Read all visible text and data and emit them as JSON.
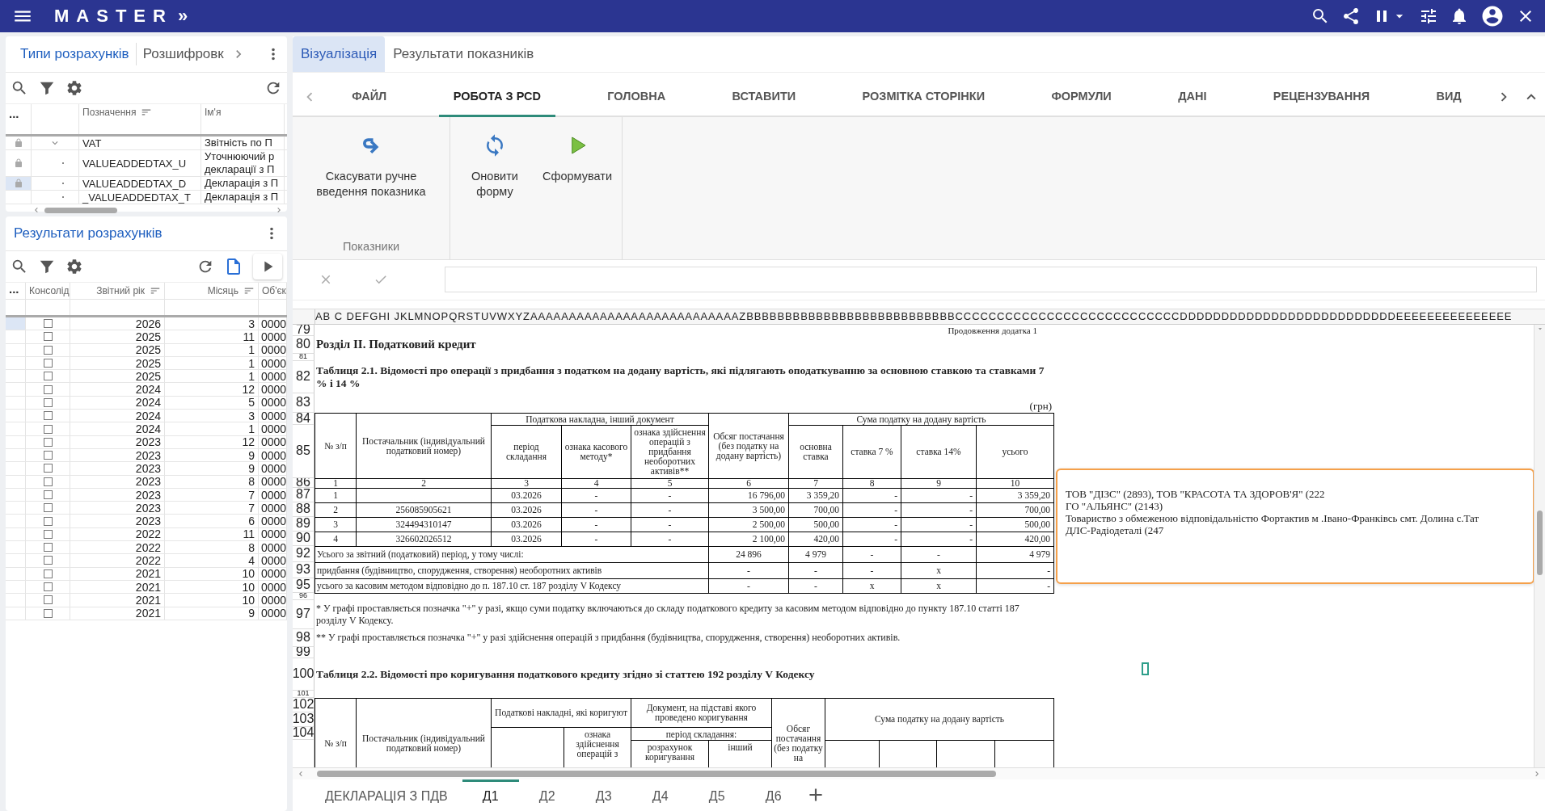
{
  "app_bar": {
    "title": "MASTER",
    "expand": "»"
  },
  "calc_types": {
    "tabs": [
      {
        "label": "Типи розрахунків",
        "selected": true
      },
      {
        "label": "Розшифровк",
        "selected": false
      }
    ],
    "more_label": "...",
    "columns": [
      {
        "label": "Позначення",
        "sorted": true
      },
      {
        "label": "Ім'я",
        "sorted": false
      }
    ],
    "rows": [
      {
        "code": "VAT",
        "name": "Звітність по П",
        "locked": true,
        "selected": false,
        "expanded": true,
        "children": [
          {
            "code": "VALUEADDEDTAX_U",
            "name": "Уточнюючий р декларації з П",
            "locked": true,
            "selected": false
          },
          {
            "code": "VALUEADDEDTAX_D",
            "name": "Декларація з П",
            "locked": true,
            "selected": true
          },
          {
            "code": "_VALUEADDEDTAX_T",
            "name": "Декларація з П",
            "locked": false,
            "selected": false
          }
        ]
      }
    ]
  },
  "calc_results": {
    "title": "Результати розрахунків",
    "more_label": "...",
    "columns": [
      {
        "label": "Консолід",
        "sorted": false
      },
      {
        "label": "Звітний рік",
        "sorted": true
      },
      {
        "label": "Місяць",
        "sorted": true
      },
      {
        "label": "Об'єк",
        "sorted": false
      }
    ],
    "rows": [
      {
        "consolidated": false,
        "year": "2026",
        "month": "3",
        "object": "0000",
        "selected": true
      },
      {
        "consolidated": false,
        "year": "2025",
        "month": "11",
        "object": "0000",
        "selected": false
      },
      {
        "consolidated": false,
        "year": "2025",
        "month": "1",
        "object": "0000",
        "selected": false
      },
      {
        "consolidated": false,
        "year": "2025",
        "month": "1",
        "object": "0000",
        "selected": false
      },
      {
        "consolidated": false,
        "year": "2025",
        "month": "1",
        "object": "0000",
        "selected": false
      },
      {
        "consolidated": false,
        "year": "2024",
        "month": "12",
        "object": "0000",
        "selected": false
      },
      {
        "consolidated": false,
        "year": "2024",
        "month": "5",
        "object": "0000",
        "selected": false
      },
      {
        "consolidated": false,
        "year": "2024",
        "month": "3",
        "object": "0000",
        "selected": false
      },
      {
        "consolidated": false,
        "year": "2024",
        "month": "1",
        "object": "0000",
        "selected": false
      },
      {
        "consolidated": false,
        "year": "2023",
        "month": "12",
        "object": "0000",
        "selected": false
      },
      {
        "consolidated": false,
        "year": "2023",
        "month": "9",
        "object": "0000",
        "selected": false
      },
      {
        "consolidated": false,
        "year": "2023",
        "month": "9",
        "object": "0000",
        "selected": false
      },
      {
        "consolidated": false,
        "year": "2023",
        "month": "8",
        "object": "0000",
        "selected": false
      },
      {
        "consolidated": false,
        "year": "2023",
        "month": "7",
        "object": "0000",
        "selected": false
      },
      {
        "consolidated": false,
        "year": "2023",
        "month": "7",
        "object": "0000",
        "selected": false
      },
      {
        "consolidated": false,
        "year": "2023",
        "month": "6",
        "object": "0000",
        "selected": false
      },
      {
        "consolidated": false,
        "year": "2022",
        "month": "11",
        "object": "0000",
        "selected": false
      },
      {
        "consolidated": false,
        "year": "2022",
        "month": "8",
        "object": "0000",
        "selected": false
      },
      {
        "consolidated": false,
        "year": "2022",
        "month": "4",
        "object": "0000",
        "selected": false
      },
      {
        "consolidated": false,
        "year": "2021",
        "month": "10",
        "object": "0000",
        "selected": false
      },
      {
        "consolidated": false,
        "year": "2021",
        "month": "10",
        "object": "0000",
        "selected": false
      },
      {
        "consolidated": false,
        "year": "2021",
        "month": "10",
        "object": "0000",
        "selected": false
      },
      {
        "consolidated": false,
        "year": "2021",
        "month": "9",
        "object": "0000",
        "selected": false
      }
    ]
  },
  "view_tabs": [
    {
      "label": "Візуалізація",
      "selected": true
    },
    {
      "label": "Результати показників",
      "selected": false
    }
  ],
  "ribbon_tabs": [
    {
      "label": "ФАЙЛ",
      "selected": false
    },
    {
      "label": "РОБОТА З РСD",
      "selected": true
    },
    {
      "label": "ГОЛОВНА",
      "selected": false
    },
    {
      "label": "ВСТАВИТИ",
      "selected": false
    },
    {
      "label": "РОЗМІТКА СТОРІНКИ",
      "selected": false
    },
    {
      "label": "ФОРМУЛИ",
      "selected": false
    },
    {
      "label": "ДАНІ",
      "selected": false
    },
    {
      "label": "РЕЦЕНЗУВАННЯ",
      "selected": false
    },
    {
      "label": "ВИД",
      "selected": false
    }
  ],
  "ribbon_groups": [
    {
      "label": "Показники",
      "buttons": [
        {
          "label": "Скасувати ручне введення показника",
          "kind": "undo"
        }
      ]
    },
    {
      "buttons": [
        {
          "label": "Оновити форму",
          "kind": "refresh"
        },
        {
          "label": "Сформувати",
          "kind": "run"
        }
      ]
    }
  ],
  "sheet": {
    "column_letters": "AB C DEFGHI JKLMNOPQRSTUVWXYZAAAAAAAAAAAAAAAAAAAAAAAAAAAZBBBBBBBBBBBBBBBBBBBBBBBBBBBCCCCCCCCCCCCCCCCCCCCCCCCCCCDDDDDDDDDDDDDDDDDDDDDDDDDDEEEEEEEEEEEEEEE",
    "blocks": [
      {
        "kind": "note",
        "row": "79",
        "text": "Продовження додатка 1"
      },
      {
        "kind": "heading",
        "row": "80",
        "text": "Розділ ІІ.  Податковий кредит"
      },
      {
        "kind": "gap",
        "row": "81"
      },
      {
        "kind": "caption",
        "row": "82",
        "text": "Таблиця 2.1. Відомості про операції з придбання з податком на додану вартість, які підлягають оподаткуванню за основною ставкою та ставками 7 % і 14 %"
      },
      {
        "kind": "unit",
        "row": "83",
        "text": "(грн)"
      },
      {
        "kind": "table",
        "rows": [
          {
            "row": "84",
            "cells": [
              {
                "text": "№ з/п",
                "rowspan": 2
              },
              {
                "text": "Постачальник (індивідуальний податковий номер)",
                "rowspan": 2
              },
              {
                "text": "Податкова накладна, інший документ",
                "colspan": 3
              },
              {
                "text": "Обсяг постачання (без податку на додану вартість)",
                "rowspan": 2
              },
              {
                "text": "Сума податку на додану вартість",
                "colspan": 4
              }
            ]
          },
          {
            "row": "85",
            "cells": [
              "період складання",
              "ознака касового методу*",
              "ознака здійснення операцій з придбання необоротних активів**",
              "основна ставка",
              "ставка 7 %",
              "ставка 14%",
              "усього"
            ]
          },
          {
            "row": "86",
            "cells": [
              "1",
              "2",
              "3",
              "4",
              "5",
              "6",
              "7",
              "8",
              "9",
              "10"
            ]
          },
          {
            "row": "87",
            "cells": [
              "1",
              null,
              "03.2026",
              "-",
              "-",
              "16 796,00",
              "3 359,20",
              "-",
              "-",
              "3 359,20"
            ]
          },
          {
            "row": "88",
            "cells": [
              "2",
              "256085905621",
              "03.2026",
              "-",
              "-",
              "3 500,00",
              "700,00",
              "-",
              "-",
              "700,00"
            ]
          },
          {
            "row": "89",
            "cells": [
              "3",
              "324494310147",
              "03.2026",
              "-",
              "-",
              "2 500,00",
              "500,00",
              "-",
              "-",
              "500,00"
            ]
          },
          {
            "row": "90",
            "cells": [
              "4",
              "326602026512",
              "03.2026",
              "-",
              "-",
              "2 100,00",
              "420,00",
              "-",
              "-",
              "420,00"
            ]
          },
          {
            "row": "92",
            "cells": [
              {
                "text": "Усього за звітний (податковий) період, у тому числі:",
                "colspan": 5
              },
              "24 896",
              "4 979",
              "-",
              "-",
              "4 979"
            ]
          },
          {
            "row": "93",
            "cells": [
              {
                "text": "придбання (будівництво, спорудження, створення) необоротних активів",
                "colspan": 5
              },
              "-",
              "-",
              "-",
              "x",
              "-"
            ]
          },
          {
            "row": "95",
            "cells": [
              {
                "text": "усього за касовим методом відповідно до п. 187.10 ст. 187 розділу V Кодексу",
                "colspan": 5
              },
              "-",
              "-",
              "x",
              "x",
              "-"
            ]
          }
        ]
      },
      {
        "kind": "gap",
        "row": "96"
      },
      {
        "kind": "footnote",
        "row": "97",
        "text": "* У графі проставляється позначка \"+\" у разі, якщо суми податку включаються до складу податкового кредиту за касовим методом відповідно до пункту 187.10 статті 187 розділу V Кодексу."
      },
      {
        "kind": "footnote",
        "row": "98",
        "text": "** У графі проставляється позначка \"+\" у разі здійснення операцій з придбання (будівництва, спорудження, створення) необоротних активів."
      },
      {
        "kind": "blank",
        "row": "99"
      },
      {
        "kind": "caption",
        "row": "100",
        "text": "Таблиця 2.2. Відомості про коригування податкового кредиту згідно зі статтею 192 розділу V Кодексу"
      },
      {
        "kind": "gap",
        "row": "101"
      },
      {
        "kind": "table",
        "rows": [
          {
            "row": "102",
            "cells": [
              {
                "text": "№ з/п",
                "rowspan": 4
              },
              {
                "text": "Постачальник (індивідуальний податковий номер)",
                "rowspan": 4
              },
              {
                "text": "Податкові накладні, які коригуют",
                "colspan": 2,
                "rowspan": 2
              },
              {
                "text": "Документ, на підставі якого проведено коригування",
                "colspan": 2,
                "rowspan": 2
              },
              {
                "text": "Обсяг постачання (без податку на",
                "rowspan": 4
              },
              {
                "text": "Сума податку на додану вартість",
                "colspan": 4,
                "rowspan": 3
              }
            ]
          },
          {
            "row": "103",
            "cells": []
          },
          {
            "row": "104",
            "cells": [
              {
                "text": null,
                "rowspan": 2
              },
              {
                "text": "ознака здійснення операцій з",
                "rowspan": 2
              },
              {
                "text": "період складання:",
                "colspan": 2
              }
            ]
          },
          {
            "cells": [
              "розрахунок коригування",
              "інший",
              null,
              null,
              null,
              null
            ]
          }
        ]
      }
    ],
    "comment": {
      "lines": [
        "ТОВ \"ДІЗС\" (2893), ТОВ \"КРАСОТА ТА ЗДОРОВ'Я\" (222",
        "ГО \"АЛЬЯНС\" (2143)",
        "Товариство з обмеженою відповідальністю Фортактив м .Івано-Франківсь смт. Долина с.Тат",
        "ДЛС-Радіодеталі (247"
      ]
    }
  },
  "sheet_tabs": [
    {
      "label": "ДЕКЛАРАЦІЯ З ПДВ",
      "selected": false
    },
    {
      "label": "Д1",
      "selected": true
    },
    {
      "label": "Д2",
      "selected": false
    },
    {
      "label": "Д3",
      "selected": false
    },
    {
      "label": "Д4",
      "selected": false
    },
    {
      "label": "Д5",
      "selected": false
    },
    {
      "label": "Д6",
      "selected": false
    }
  ]
}
